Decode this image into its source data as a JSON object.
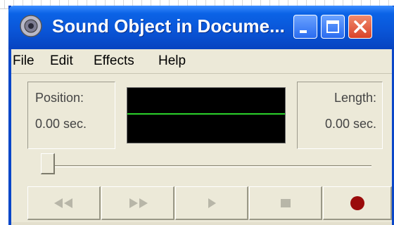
{
  "window": {
    "title": "Sound Object in Docume..."
  },
  "titlebar_buttons": [
    "minimize",
    "maximize",
    "close"
  ],
  "menu": [
    "File",
    "Edit",
    "Effects",
    "Help"
  ],
  "position": {
    "label": "Position:",
    "value": "0.00 sec."
  },
  "length": {
    "label": "Length:",
    "value": "0.00 sec."
  },
  "controls": {
    "rewind": "seek-back-icon",
    "forward": "seek-forward-icon",
    "play": "play-icon",
    "stop": "stop-icon",
    "record": "record-icon"
  },
  "colors": {
    "titlebar": "#0a56d8",
    "wave_bg": "#000000",
    "wave_line": "#2bd12b",
    "record": "#9a0b0b"
  }
}
